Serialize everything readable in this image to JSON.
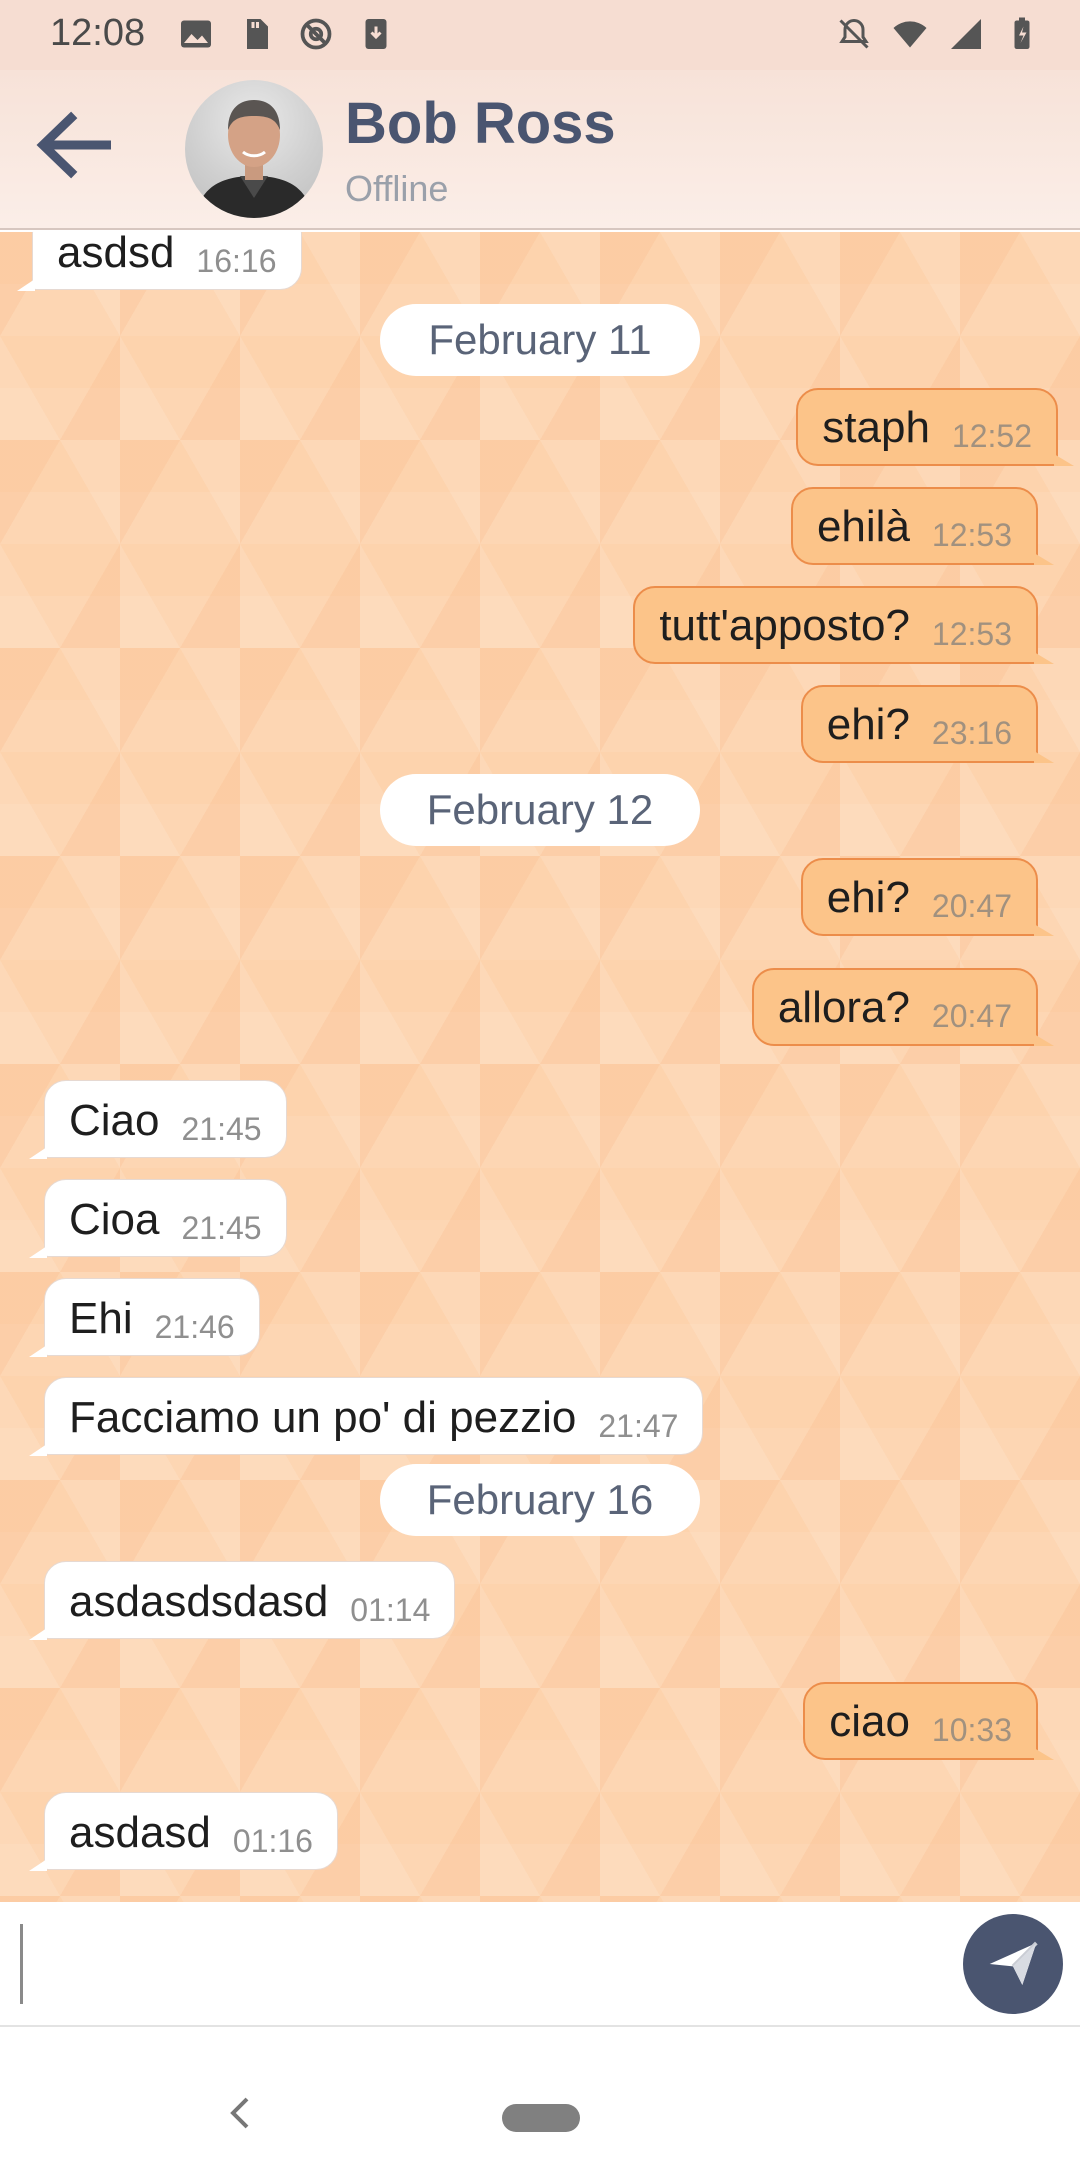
{
  "status_bar": {
    "time": "12:08",
    "left_icons": [
      "image-icon",
      "sd-card-icon",
      "at-sign-icon",
      "download-icon"
    ],
    "right_icons": [
      "notifications-off-icon",
      "wifi-icon",
      "signal-icon",
      "battery-icon"
    ]
  },
  "header": {
    "back_icon": "arrow-left-icon",
    "contact_name": "Bob Ross",
    "contact_status": "Offline"
  },
  "messages": [
    {
      "type": "in",
      "text": "asdsd",
      "time": "16:16"
    },
    {
      "type": "date",
      "text": "February 11"
    },
    {
      "type": "out",
      "text": "staph",
      "time": "12:52"
    },
    {
      "type": "out",
      "text": "ehilà",
      "time": "12:53"
    },
    {
      "type": "out",
      "text": "tutt'apposto?",
      "time": "12:53"
    },
    {
      "type": "out",
      "text": "ehi?",
      "time": "23:16"
    },
    {
      "type": "date",
      "text": "February 12"
    },
    {
      "type": "out",
      "text": "ehi?",
      "time": "20:47"
    },
    {
      "type": "out",
      "text": "allora?",
      "time": "20:47"
    },
    {
      "type": "in",
      "text": "Ciao",
      "time": "21:45"
    },
    {
      "type": "in",
      "text": "Cioa",
      "time": "21:45"
    },
    {
      "type": "in",
      "text": "Ehi",
      "time": "21:46"
    },
    {
      "type": "in",
      "text": "Facciamo un po' di pezzio",
      "time": "21:47"
    },
    {
      "type": "date",
      "text": "February 16"
    },
    {
      "type": "in",
      "text": "asdasdsdasd",
      "time": "01:14"
    },
    {
      "type": "out",
      "text": "ciao",
      "time": "10:33"
    },
    {
      "type": "in",
      "text": "asdasd",
      "time": "01:16"
    }
  ],
  "composer": {
    "value": "",
    "placeholder": "",
    "send_icon": "send-icon"
  },
  "nav_bar": {
    "back_icon": "nav-back-icon",
    "home_icon": "home-pill-icon"
  },
  "colors": {
    "accent": "#4a5570",
    "outgoing_bubble": "#fcc489",
    "outgoing_border": "#ec8d4a",
    "incoming_bubble": "#ffffff",
    "chat_background": "#fdd3ad"
  }
}
